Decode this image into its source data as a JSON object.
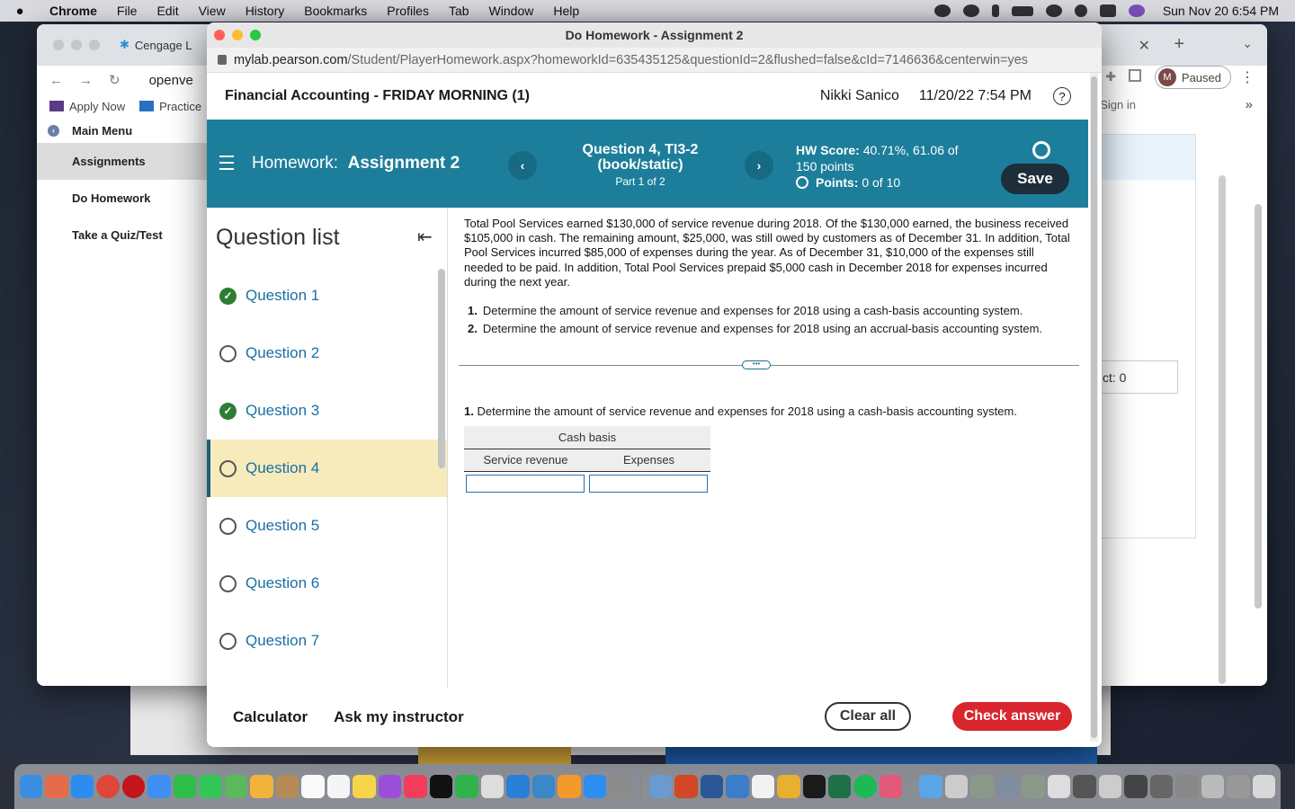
{
  "menubar": {
    "app": "Chrome",
    "items": [
      "File",
      "Edit",
      "View",
      "History",
      "Bookmarks",
      "Profiles",
      "Tab",
      "Window",
      "Help"
    ],
    "clock": "Sun Nov 20  6:54 PM"
  },
  "bg_window": {
    "tab_title": "Cengage L",
    "url": "openve",
    "bookmarks": [
      "Apply Now",
      "Practice"
    ],
    "profile_initial": "M",
    "profile_status": "Paused",
    "sign_in": "Sign in",
    "nav": {
      "main_menu": "Main Menu",
      "items": [
        "Assignments",
        "Do Homework",
        "Take a Quiz/Test"
      ]
    },
    "count_fragment": "ct: 0"
  },
  "popup": {
    "window_title": "Do Homework - Assignment 2",
    "url_host": "mylab.pearson.com",
    "url_path": "/Student/PlayerHomework.aspx?homeworkId=635435125&questionId=2&flushed=false&cId=7146636&centerwin=yes"
  },
  "header": {
    "course": "Financial Accounting - FRIDAY MORNING (1)",
    "user": "Nikki Sanico",
    "datetime": "11/20/22 7:54 PM",
    "help": "?"
  },
  "hwbar": {
    "homework_label": "Homework:",
    "assignment": "Assignment 2",
    "question_title": "Question 4, TI3-2 (book/static)",
    "part": "Part 1 of 2",
    "hw_score_label": "HW Score:",
    "hw_score_value": "40.71%, 61.06 of 150 points",
    "points_label": "Points:",
    "points_value": "0 of 10",
    "save": "Save"
  },
  "question_list": {
    "title": "Question list",
    "items": [
      {
        "label": "Question 1",
        "done": true
      },
      {
        "label": "Question 2",
        "done": false
      },
      {
        "label": "Question 3",
        "done": true
      },
      {
        "label": "Question 4",
        "done": false
      },
      {
        "label": "Question 5",
        "done": false
      },
      {
        "label": "Question 6",
        "done": false
      },
      {
        "label": "Question 7",
        "done": false
      }
    ],
    "current_index": 3
  },
  "question": {
    "body": "Total Pool Services earned $130,000 of service revenue during 2018. Of the $130,000 earned, the business received $105,000 in cash. The remaining amount, $25,000, was still owed by customers as of December 31. In addition, Total Pool Services incurred $85,000 of expenses during the year. As of December 31, $10,000 of the expenses still needed to be paid. In addition, Total Pool Services prepaid $5,000 cash in December 2018 for expenses incurred during the next year.",
    "tasks": [
      {
        "num": "1.",
        "text": "Determine the amount of service revenue and expenses for 2018 using a cash-basis accounting system."
      },
      {
        "num": "2.",
        "text": "Determine the amount of service revenue and expenses for 2018 using an accrual-basis accounting system."
      }
    ],
    "part_prompt_num": "1.",
    "part_prompt_text": "Determine the amount of service revenue and expenses for 2018 using a cash-basis accounting system.",
    "table": {
      "group_header": "Cash basis",
      "col1": "Service revenue",
      "col2": "Expenses",
      "value1": "",
      "value2": ""
    }
  },
  "footer": {
    "calculator": "Calculator",
    "ask": "Ask my instructor",
    "clear_all": "Clear all",
    "check_answer": "Check answer"
  },
  "colors": {
    "hwbar_bg": "#1c7e9a",
    "current_question_bg": "#f7ebbb",
    "check_answer_bg": "#d9252d",
    "save_bg": "#1d2d3a",
    "done_check": "#2e7d32"
  }
}
